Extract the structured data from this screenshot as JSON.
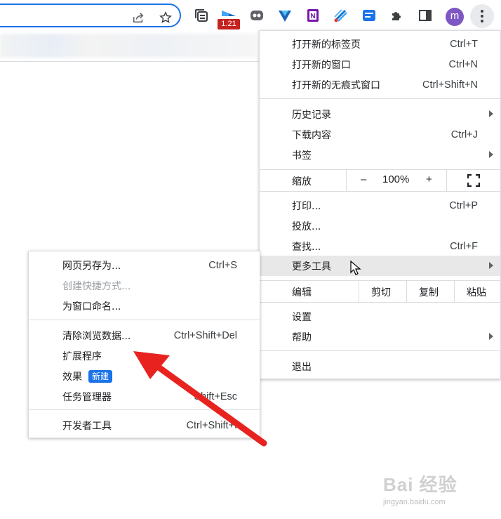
{
  "toolbar": {
    "extension_badge": "1.21",
    "avatar_letter": "m",
    "icons": [
      "share-icon",
      "bookmark-star-icon",
      "tab-search-icon",
      "extension-icon-1",
      "extension-icon-2",
      "extension-icon-3",
      "onenote-icon",
      "extension-icon-4",
      "extension-icon-5",
      "puzzle-icon",
      "side-panel-icon",
      "avatar",
      "more-menu-icon"
    ]
  },
  "main_menu": {
    "new_tab": {
      "label": "打开新的标签页",
      "accel": "Ctrl+T"
    },
    "new_window": {
      "label": "打开新的窗口",
      "accel": "Ctrl+N"
    },
    "incognito": {
      "label": "打开新的无痕式窗口",
      "accel": "Ctrl+Shift+N"
    },
    "history": {
      "label": "历史记录"
    },
    "downloads": {
      "label": "下载内容",
      "accel": "Ctrl+J"
    },
    "bookmarks": {
      "label": "书签"
    },
    "zoom": {
      "label": "缩放",
      "minus": "–",
      "value": "100%",
      "plus": "+"
    },
    "print": {
      "label": "打印...",
      "accel": "Ctrl+P"
    },
    "cast": {
      "label": "投放..."
    },
    "find": {
      "label": "查找...",
      "accel": "Ctrl+F"
    },
    "more_tools": {
      "label": "更多工具"
    },
    "edit": {
      "label": "编辑",
      "cut": "剪切",
      "copy": "复制",
      "paste": "粘贴"
    },
    "settings": {
      "label": "设置"
    },
    "help": {
      "label": "帮助"
    },
    "exit": {
      "label": "退出"
    }
  },
  "sub_menu": {
    "save_page": {
      "label": "网页另存为...",
      "accel": "Ctrl+S"
    },
    "create_shortcut": {
      "label": "创建快捷方式..."
    },
    "name_window": {
      "label": "为窗口命名..."
    },
    "clear_data": {
      "label": "清除浏览数据...",
      "accel": "Ctrl+Shift+Del"
    },
    "extensions": {
      "label": "扩展程序"
    },
    "effects": {
      "label": "效果",
      "badge": "新建"
    },
    "task_manager": {
      "label": "任务管理器",
      "accel": "Shift+Esc"
    },
    "dev_tools": {
      "label": "开发者工具",
      "accel": "Ctrl+Shift+I"
    }
  },
  "watermark": {
    "main": "Bai 经验",
    "sub": "jingyan.baidu.com"
  },
  "colors": {
    "accent": "#1a73e8",
    "annotation_arrow": "#e8231f",
    "highlight": "#e8e8e9"
  }
}
